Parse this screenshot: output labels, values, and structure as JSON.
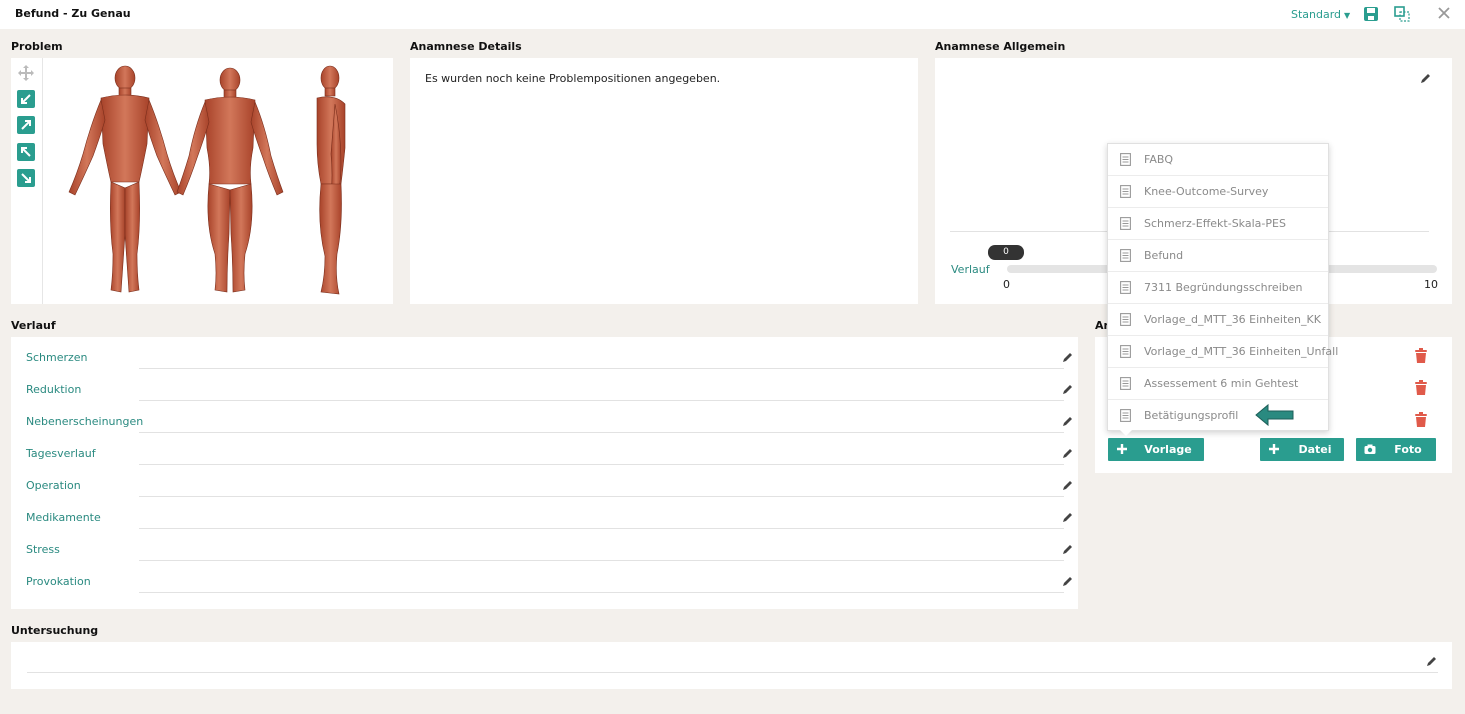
{
  "header": {
    "title": "Befund - Zu Genau",
    "view_select": "Standard"
  },
  "sections": {
    "problem": "Problem",
    "anamnese_details": "Anamnese Details",
    "anamnese_allgemein": "Anamnese Allgemein",
    "verlauf": "Verlauf",
    "anhang": "An",
    "untersuchung": "Untersuchung"
  },
  "anamnese_details": {
    "empty_text": "Es wurden noch keine Problempositionen angegeben."
  },
  "slider": {
    "label": "Verlauf",
    "value": "0",
    "min": "0",
    "max": "10"
  },
  "verlauf_items": [
    "Schmerzen",
    "Reduktion",
    "Nebenerscheinungen",
    "Tagesverlauf",
    "Operation",
    "Medikamente",
    "Stress",
    "Provokation"
  ],
  "template_menu": [
    "FABQ",
    "Knee-Outcome-Survey",
    "Schmerz-Effekt-Skala-PES",
    "Befund",
    "7311 Begründungsschreiben",
    "Vorlage_d_MTT_36 Einheiten_KK",
    "Vorlage_d_MTT_36 Einheiten_Unfall",
    "Assessement 6 min Gehtest",
    "Betätigungsprofil"
  ],
  "buttons": {
    "vorlage": "Vorlage",
    "datei": "Datei",
    "foto": "Foto"
  },
  "colors": {
    "accent": "#2a9d8f",
    "link": "#2a8a80",
    "delete": "#e05a4a"
  }
}
